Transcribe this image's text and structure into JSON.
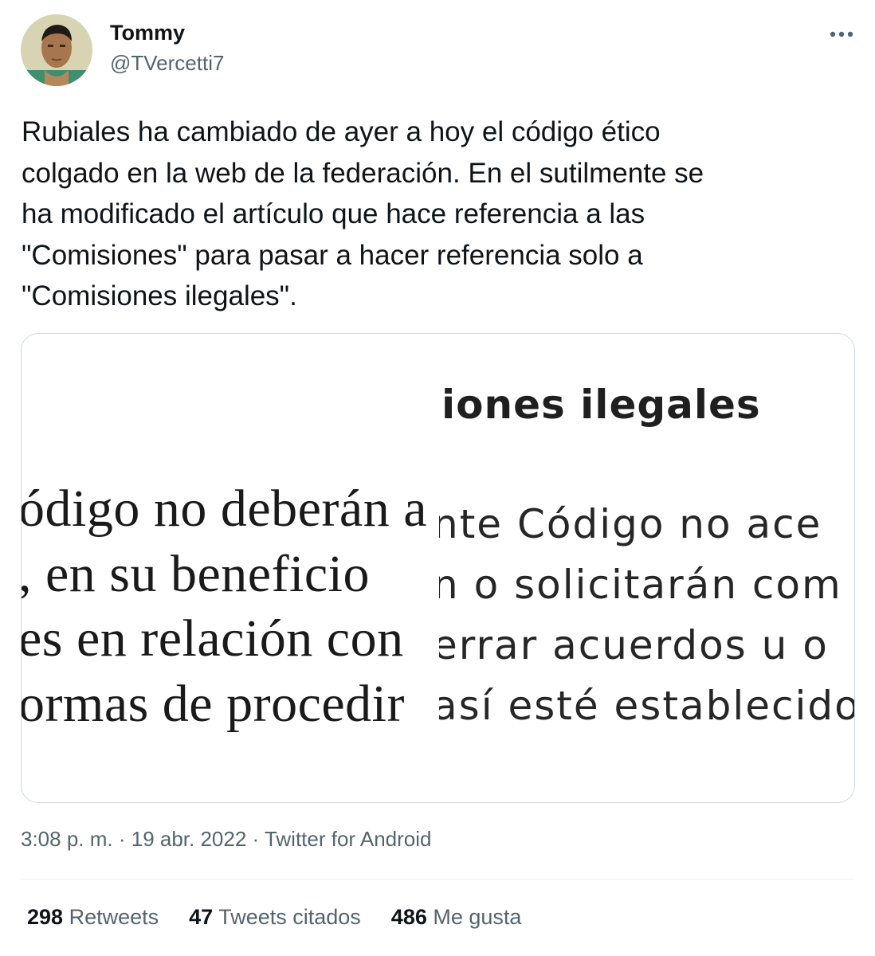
{
  "author": {
    "name": "Tommy",
    "handle": "@TVercetti7"
  },
  "tweet": {
    "text": "Rubiales ha cambiado de ayer a hoy el código ético\ncolgado en la web de la federación. En el sutilmente se\nha modificado el artículo que hace referencia a las\n\"Comisiones\" para pasar a hacer referencia solo a\n\"Comisiones ilegales\"."
  },
  "media": {
    "left_lines": [
      "ódigo no deberán a",
      ", en su beneficio",
      "es en relación con",
      "ormas de procedir"
    ],
    "right_heading": "iones ilegales",
    "right_lines": [
      "nte Código no ace",
      "n o solicitarán com",
      "errar acuerdos u o",
      "así esté establecido"
    ]
  },
  "meta": {
    "time": "3:08 p. m.",
    "sep1": " · ",
    "date": "19 abr. 2022",
    "sep2": " · ",
    "source": "Twitter for Android"
  },
  "stats": {
    "retweets_count": "298",
    "retweets_label": "Retweets",
    "quotes_count": "47",
    "quotes_label": "Tweets citados",
    "likes_count": "486",
    "likes_label": "Me gusta"
  },
  "colors": {
    "text_primary": "#0f1419",
    "text_secondary": "#536471",
    "border": "#cfd9de"
  },
  "icons": {
    "more": "more-horizontal-icon"
  }
}
